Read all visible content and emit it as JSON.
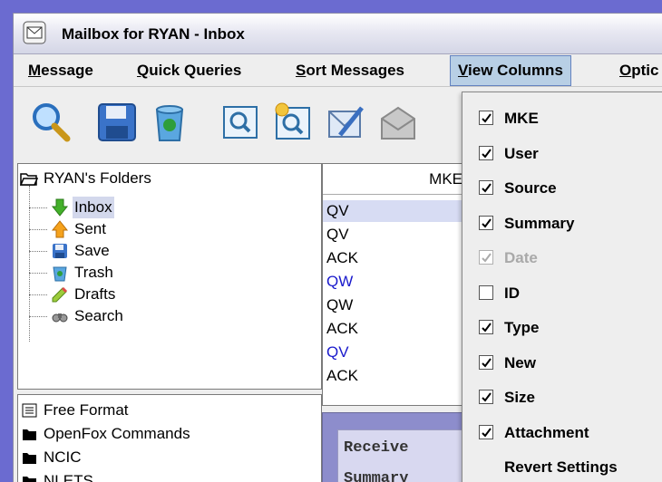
{
  "window": {
    "title": "Mailbox for RYAN - Inbox"
  },
  "menu": [
    {
      "label": "Message",
      "mnemonic": "M",
      "rest": "essage"
    },
    {
      "label": "Quick Queries",
      "mnemonic": "Q",
      "rest": "uick Queries"
    },
    {
      "label": "Sort Messages",
      "mnemonic": "S",
      "rest": "ort Messages"
    },
    {
      "label": "View Columns",
      "mnemonic": "V",
      "rest": "iew Columns"
    },
    {
      "label": "Optic",
      "mnemonic": "O",
      "rest": "ptic"
    }
  ],
  "toolbar": {
    "icons": [
      "search-icon",
      "save-icon",
      "recycle-trash-icon",
      "find-message-icon",
      "new-search-icon",
      "compose-icon",
      "mail-icon"
    ]
  },
  "folders": {
    "root": "RYAN's Folders",
    "items": [
      "Inbox",
      "Sent",
      "Save",
      "Trash",
      "Drafts",
      "Search"
    ],
    "selected": "Inbox"
  },
  "tools_list": [
    "Free Format",
    "OpenFox Commands",
    "NCIC",
    "NLETS"
  ],
  "messages": {
    "column_header": "MKE",
    "rows": [
      {
        "mke": "QV",
        "color": "#000000",
        "selected": true
      },
      {
        "mke": "QV",
        "color": "#000000",
        "selected": false
      },
      {
        "mke": "ACK",
        "color": "#000000",
        "selected": false
      },
      {
        "mke": "QW",
        "color": "#1a1acc",
        "selected": false
      },
      {
        "mke": "QW",
        "color": "#000000",
        "selected": false
      },
      {
        "mke": "ACK",
        "color": "#000000",
        "selected": false
      },
      {
        "mke": "QV",
        "color": "#1a1acc",
        "selected": false
      },
      {
        "mke": "ACK",
        "color": "#000000",
        "selected": false
      }
    ]
  },
  "detail": {
    "line1": "Receive",
    "line2": "Summary"
  },
  "view_columns_menu": [
    {
      "label": "MKE",
      "checked": true,
      "enabled": true
    },
    {
      "label": "User",
      "checked": true,
      "enabled": true
    },
    {
      "label": "Source",
      "checked": true,
      "enabled": true
    },
    {
      "label": "Summary",
      "checked": true,
      "enabled": true
    },
    {
      "label": "Date",
      "checked": true,
      "enabled": false
    },
    {
      "label": "ID",
      "checked": false,
      "enabled": true
    },
    {
      "label": "Type",
      "checked": true,
      "enabled": true
    },
    {
      "label": "New",
      "checked": true,
      "enabled": true
    },
    {
      "label": "Size",
      "checked": true,
      "enabled": true
    },
    {
      "label": "Attachment",
      "checked": true,
      "enabled": true
    },
    {
      "label": "Revert Settings",
      "checked": null,
      "enabled": true
    }
  ],
  "colors": {
    "titlebar": "#dcdcea",
    "menu_active": "#b8cfe5",
    "selection": "#d7dcf3",
    "desktop": "#6b6bd0"
  }
}
